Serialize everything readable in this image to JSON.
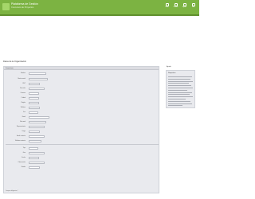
{
  "header": {
    "app_title": "Plataforma de Gestión",
    "app_subtitle": "Concursos de Proyectos",
    "icons": [
      {
        "name": "home-icon",
        "label": "Inicio"
      },
      {
        "name": "user-icon",
        "label": "Usuario"
      },
      {
        "name": "help-icon",
        "label": "Ayuda"
      },
      {
        "name": "exit-icon",
        "label": "Salir"
      }
    ]
  },
  "page": {
    "title": "Datos de la Organización"
  },
  "form": {
    "section_label": "Formulario",
    "rows": [
      {
        "label": "Nombre",
        "value": ""
      },
      {
        "label": "Razón social",
        "value": "Nombre"
      },
      {
        "label": "RUT",
        "value": ""
      },
      {
        "label": "Dirección",
        "value": ""
      },
      {
        "label": "Comuna",
        "value": ""
      },
      {
        "label": "Ciudad",
        "value": ""
      },
      {
        "label": "Región",
        "value": ""
      },
      {
        "label": "Teléfono",
        "value": ""
      },
      {
        "label": "Fax",
        "value": ""
      },
      {
        "label": "Email",
        "value": ""
      },
      {
        "label": "Sitio web",
        "value": ""
      },
      {
        "label": "Representante",
        "value": ""
      },
      {
        "label": "Cargo",
        "value": ""
      },
      {
        "label": "Email contacto",
        "value": ""
      },
      {
        "label": "Teléfono contacto",
        "value": ""
      },
      {
        "label": "Tipo",
        "value": ""
      },
      {
        "label": "Giro",
        "value": ""
      },
      {
        "label": "Fecha",
        "value": ""
      },
      {
        "label": "Observación",
        "value": ""
      },
      {
        "label": "Estado",
        "value": ""
      }
    ],
    "footer_note": "Campos obligatorios *"
  },
  "help": {
    "label": "Ayuda",
    "title": "Requisitos",
    "lines": 14
  }
}
